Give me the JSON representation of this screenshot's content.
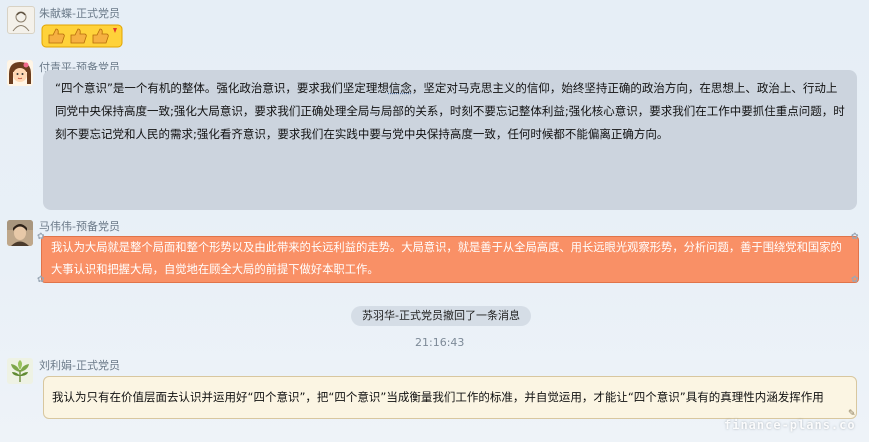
{
  "messages": [
    {
      "sender": "朱献蝶-正式党员",
      "avatar_icon": "sketch-avatar-icon",
      "content_icon": "thumbs-up-emoji-icon"
    },
    {
      "sender": "付青平-预备党员",
      "avatar_icon": "cartoon-girl-avatar-icon",
      "text_a": "“四个意识”是一个有机的整体。强化政治意识，要求我们坚定理想",
      "text_b": "信念",
      "text_c": "，坚定对马克思主义的信仰，始终坚持正确的政治方向，在思想上、政治上、行动上同党中央保持高度一致;强化大局意识，要求我们正确处理全局与局部的关系，时刻不要忘记整体利益;强化核心意识，要求我们在工作中要抓住重点问题，时刻不要忘记党和人民的需求;强化看齐意识，要求我们在实践中要与党中央保持高度一致，任何时候都不能偏离正确方向。"
    },
    {
      "sender": "马伟伟-预备党员",
      "avatar_icon": "photo-avatar-icon",
      "text": "我认为大局就是整个局面和整个形势以及由此带来的长远利益的走势。大局意识，就是善于从全局高度、用长远眼光观察形势，分析问题，善于围绕党和国家的大事认识和把握大局，自觉地在顾全大局的前提下做好本职工作。"
    },
    {
      "sender": "刘利娟-正式党员",
      "avatar_icon": "flower-avatar-icon",
      "text": "我认为只有在价值层面去认识并运用好“四个意识”，把“四个意识”当成衡量我们工作的标准，并自觉运用，才能让“四个意识”具有的真理性内涵发挥作用"
    }
  ],
  "system": {
    "recall_notice": "苏羽华-正式党员撤回了一条消息",
    "timestamp": "21:16:43"
  },
  "watermark": "finance-plans.co",
  "colors": {
    "background": "#e8eff6",
    "bubble_gray": "#ccd4de",
    "bubble_orange": "#f99066",
    "bubble_beige": "#fbf5e3",
    "sender_text": "#6b7a89"
  }
}
